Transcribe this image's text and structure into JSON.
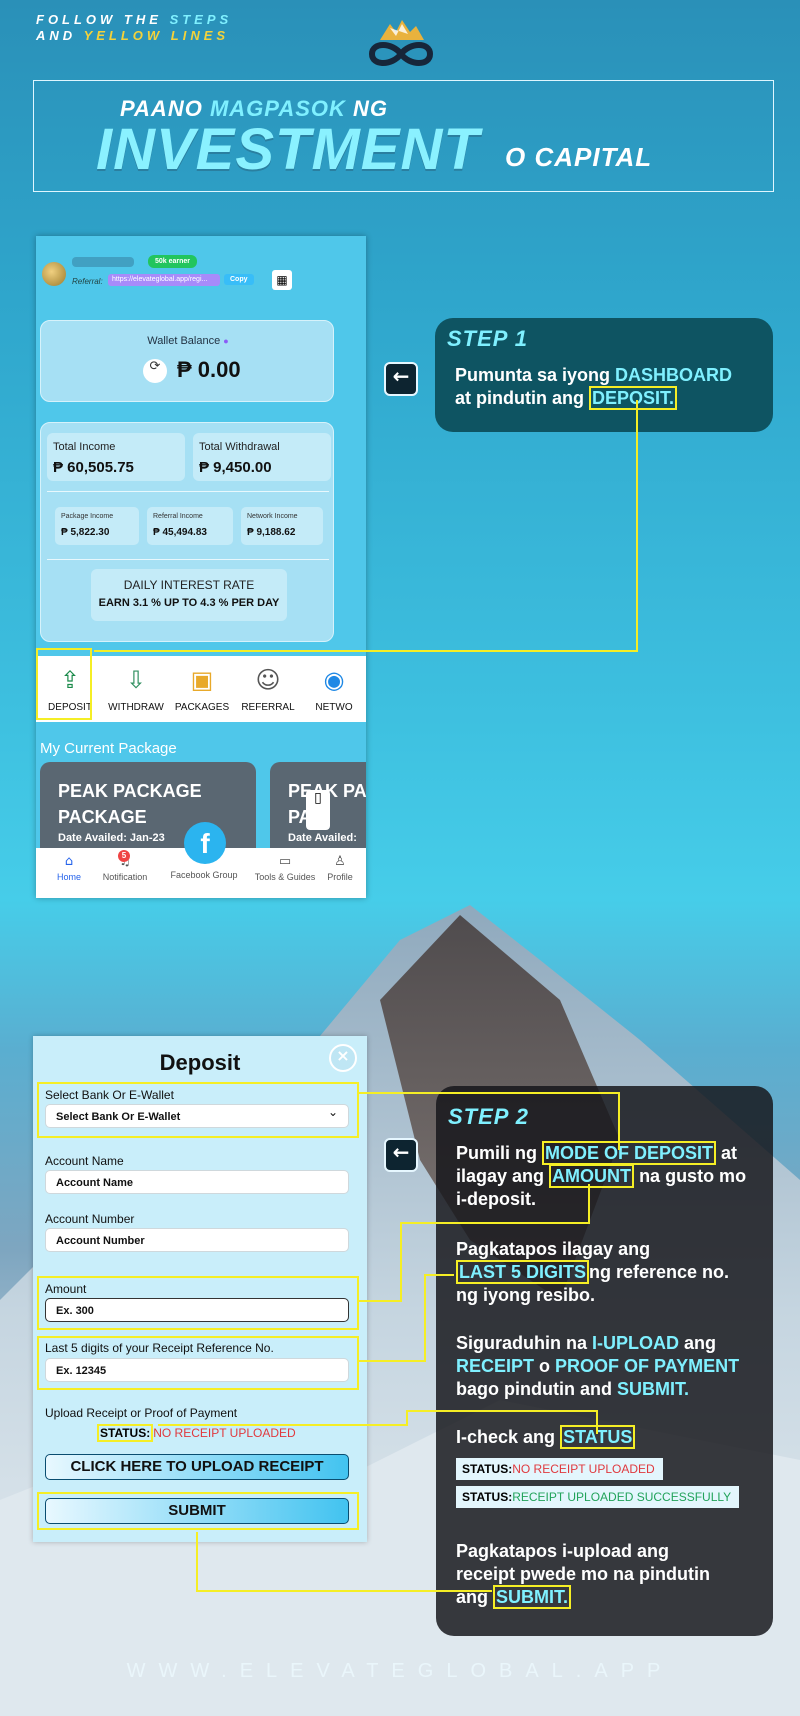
{
  "header": {
    "follow_line1_a": "FOLLOW THE",
    "follow_line1_b": "STEPS",
    "follow_line2_a": "AND",
    "follow_line2_b": "YELLOW LINES",
    "title_a": "PAANO",
    "title_b": "MAGPASOK",
    "title_c": "NG",
    "title_main": "INVESTMENT",
    "title_sub": "O CAPITAL",
    "logo_icon": "infinity-mountain-logo"
  },
  "dashboard": {
    "badge": "50k earner",
    "referral_label": "Referral:",
    "referral_link": "https://elevateglobal.app/regi...",
    "copy_label": "Copy",
    "wallet_label": "Wallet Balance",
    "wallet_value": "₱ 0.00",
    "total_income_label": "Total Income",
    "total_income_value": "₱ 60,505.75",
    "total_withdrawal_label": "Total Withdrawal",
    "total_withdrawal_value": "₱ 9,450.00",
    "package_income_label": "Package Income",
    "package_income_value": "₱ 5,822.30",
    "referral_income_label": "Referral Income",
    "referral_income_value": "₱ 45,494.83",
    "network_income_label": "Network Income",
    "network_income_value": "₱ 9,188.62",
    "rate_label": "DAILY INTEREST RATE",
    "rate_value": "EARN 3.1 % UP TO 4.3 % PER DAY",
    "nav": [
      "DEPOSIT",
      "WITHDRAW",
      "PACKAGES",
      "REFERRAL",
      "NETWO"
    ],
    "current_package_label": "My Current Package",
    "pkg1_title": "PEAK PACKAGE PACKAGE",
    "pkg1_date": "Date Availed: Jan-23",
    "pkg2_title": "PEAK PA PAC",
    "pkg2_date": "Date Availed:",
    "bottom": {
      "home": "Home",
      "notification": "Notification",
      "notification_count": "5",
      "facebook": "Facebook Group",
      "tools": "Tools & Guides",
      "profile": "Profile"
    }
  },
  "step1": {
    "title": "STEP 1",
    "line1_a": "Pumunta sa iyong",
    "line1_b": "DASHBOARD",
    "line2_a": "at pindutin ang",
    "line2_b": "DEPOSIT."
  },
  "deposit": {
    "title": "Deposit",
    "bank_label": "Select Bank Or E-Wallet",
    "bank_value": "Select Bank Or E-Wallet",
    "account_name_label": "Account Name",
    "account_name_placeholder": "Account Name",
    "account_number_label": "Account Number",
    "account_number_placeholder": "Account Number",
    "amount_label": "Amount",
    "amount_placeholder": "Ex. 300",
    "digits_label": "Last 5 digits of your Receipt Reference No.",
    "digits_placeholder": "Ex. 12345",
    "upload_label": "Upload Receipt or Proof of Payment",
    "status_label": "STATUS:",
    "status_value": "NO RECEIPT UPLOADED",
    "upload_button": "CLICK HERE TO UPLOAD RECEIPT",
    "submit_button": "SUBMIT"
  },
  "step2": {
    "title": "STEP 2",
    "p1_a": "Pumili ng",
    "p1_b": "MODE OF DEPOSIT",
    "p1_c": "at",
    "p1_d": "ilagay ang",
    "p1_e": "AMOUNT",
    "p1_f": "na gusto mo",
    "p1_g": "i-deposit.",
    "p2_a": "Pagkatapos ilagay ang",
    "p2_b": "LAST 5 DIGITS",
    "p2_c": "ng reference no.",
    "p2_d": "ng iyong resibo.",
    "p3_a": "Siguraduhin na",
    "p3_b": "I-UPLOAD",
    "p3_c": "ang",
    "p3_d": "RECEIPT",
    "p3_e": "o",
    "p3_f": "PROOF OF PAYMENT",
    "p3_g": "bago pindutin and",
    "p3_h": "SUBMIT.",
    "p4_a": "I-check ang",
    "p4_b": "STATUS",
    "status_label": "STATUS:",
    "status_no": "NO RECEIPT UPLOADED",
    "status_ok": "RECEIPT UPLOADED SUCCESSFULLY",
    "p5_a": "Pagkatapos i-upload ang",
    "p5_b": "receipt pwede mo na pindutin",
    "p5_c": "ang",
    "p5_d": "SUBMIT."
  },
  "footer": "WWW.ELEVATEGLOBAL.APP",
  "colors": {
    "accent": "#7ff0ff",
    "highlight": "#f5ee25",
    "step_box": "#0e5462"
  }
}
